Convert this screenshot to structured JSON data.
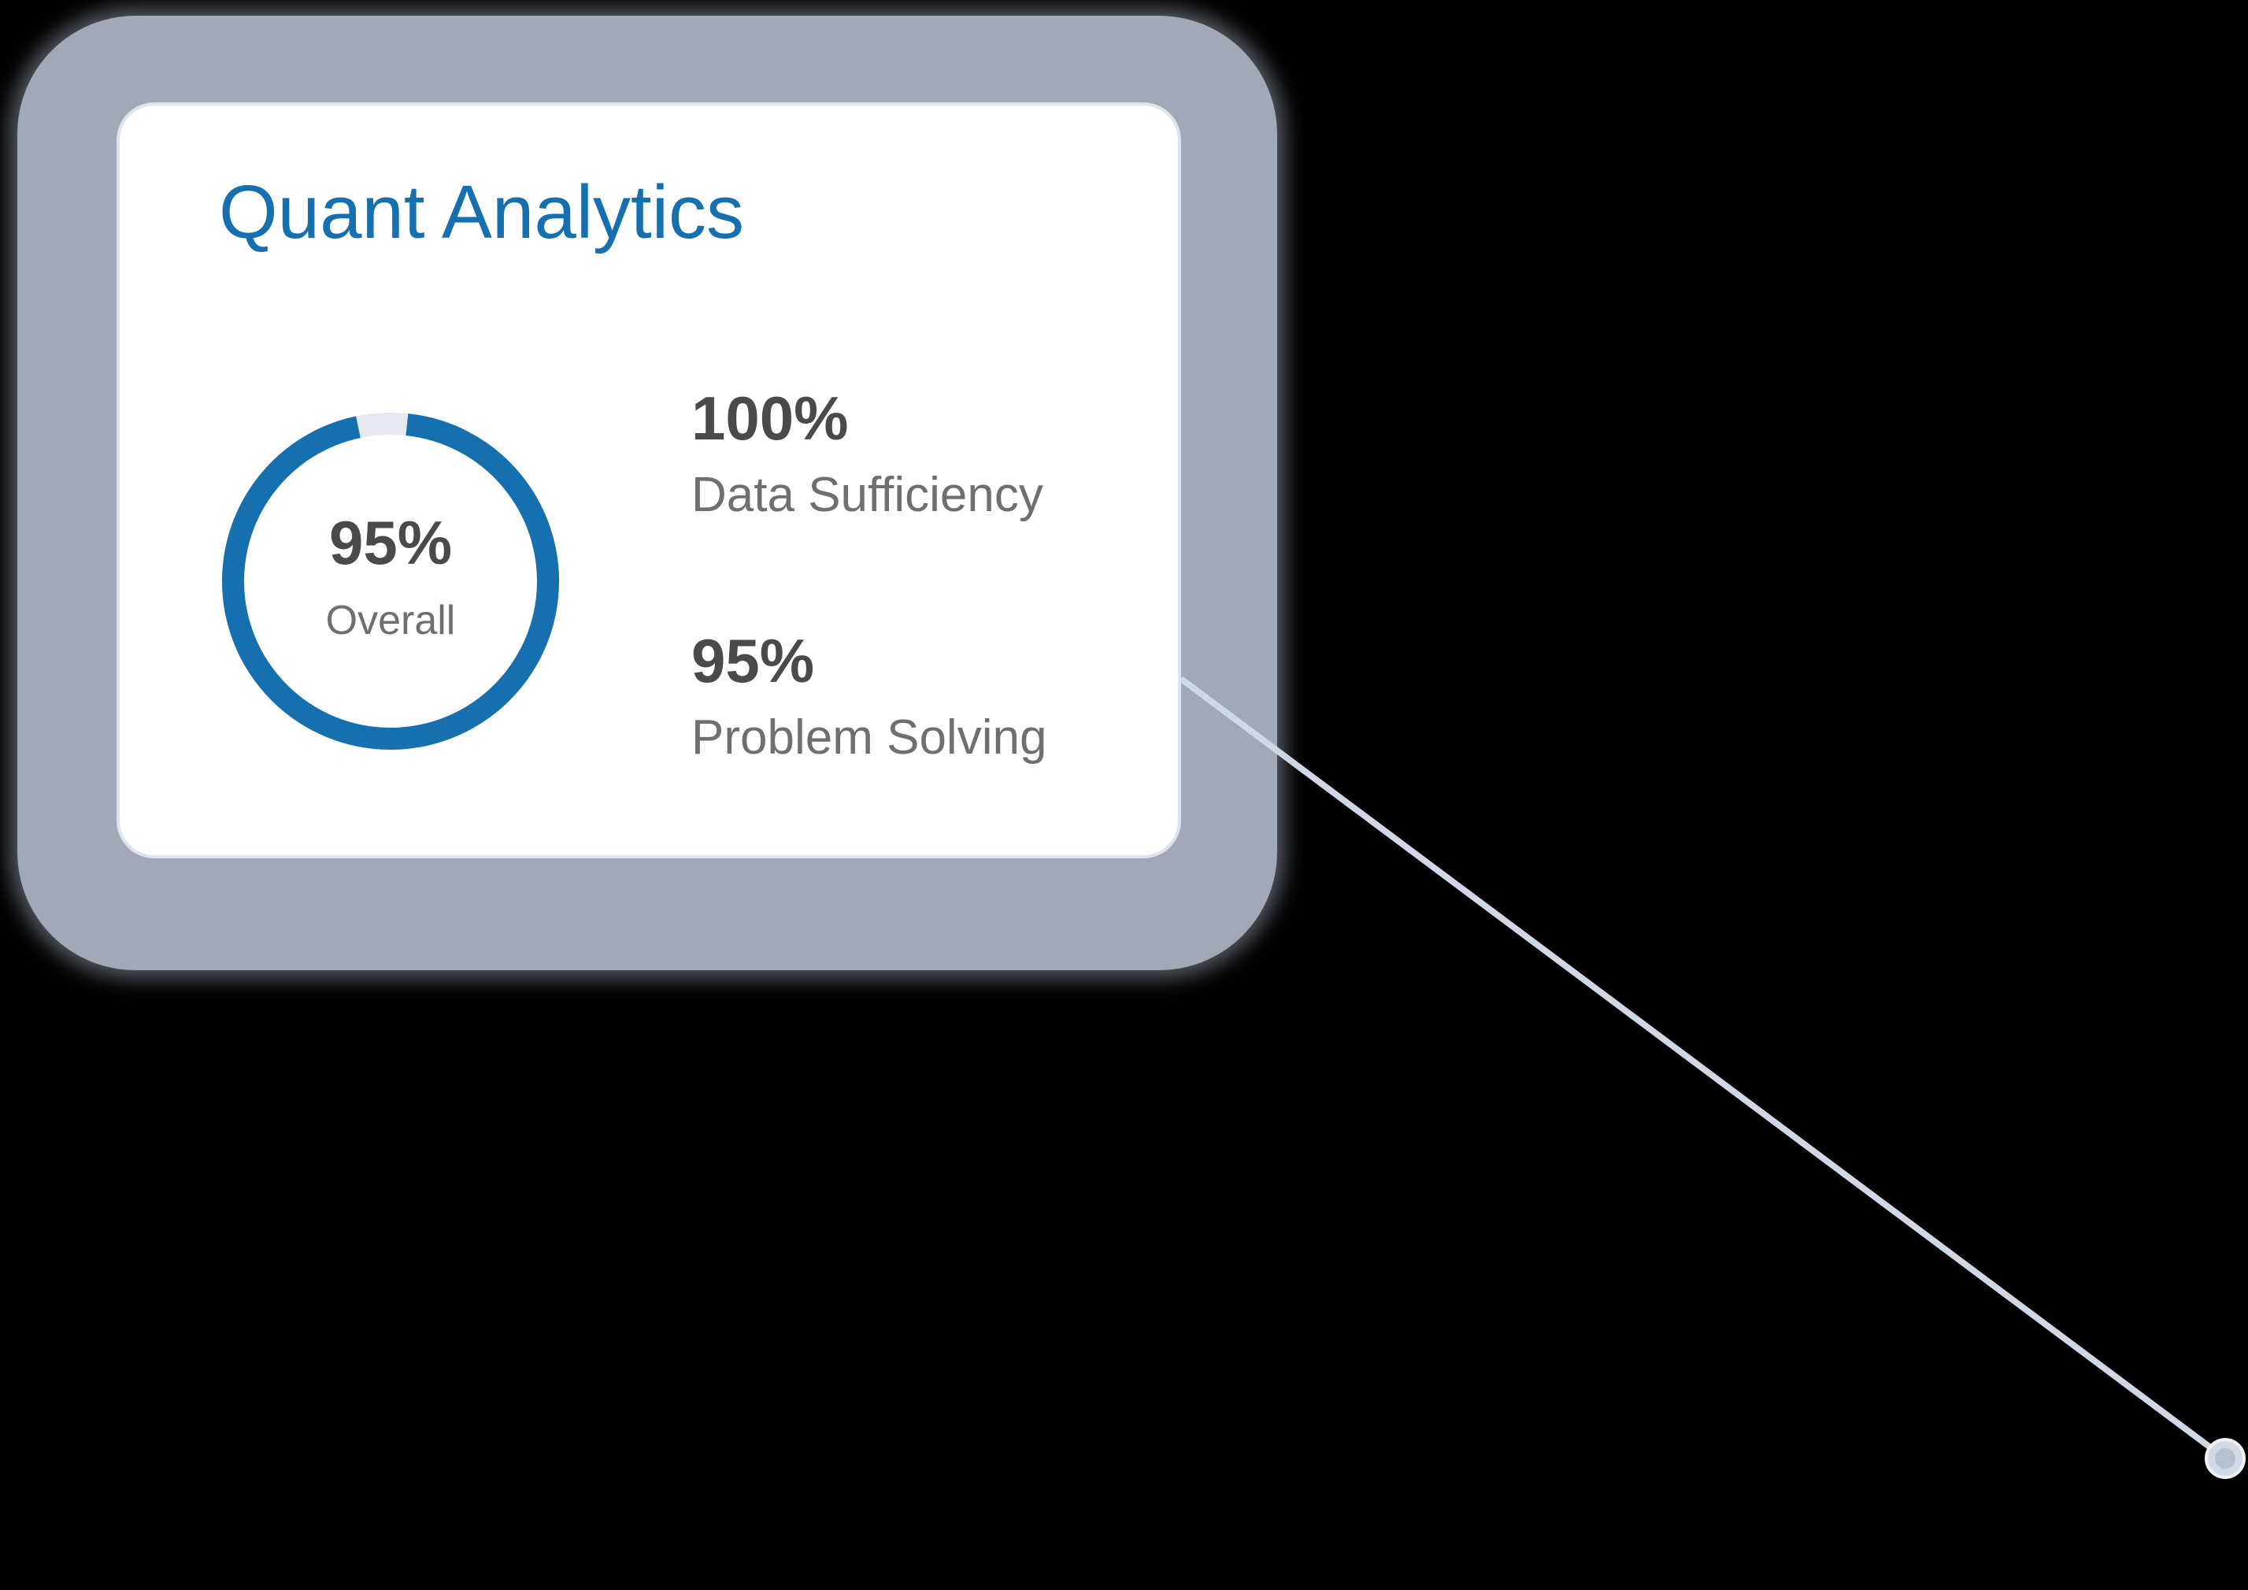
{
  "card": {
    "title": "Quant Analytics",
    "overall": {
      "value": "95%",
      "label": "Overall",
      "progress_fraction": 0.95
    },
    "stats": [
      {
        "value": "100%",
        "label": "Data Sufficiency"
      },
      {
        "value": "95%",
        "label": "Problem Solving"
      }
    ]
  },
  "colors": {
    "accent": "#1670b0",
    "ring_track": "#e6eaf0",
    "connector": "#cfd8e4",
    "background": "#000000"
  }
}
